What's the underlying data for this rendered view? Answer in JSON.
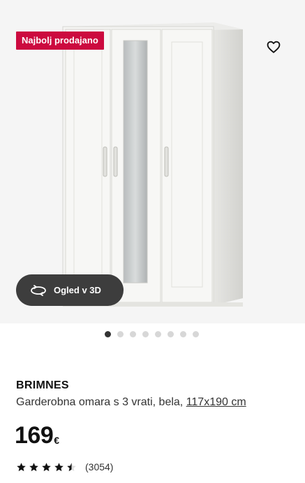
{
  "badge": {
    "label": "Najbolj prodajano"
  },
  "viewer": {
    "label": "Ogled v 3D"
  },
  "gallery": {
    "slides": 8,
    "active_index": 0
  },
  "product": {
    "brand": "BRIMNES",
    "description": "Garderobna omara s 3 vrati, bela,",
    "size_link": "117x190 cm",
    "price": "169",
    "currency": "€",
    "rating": 4.5,
    "rating_max": 5,
    "review_count": "(3054)"
  },
  "colors": {
    "badge": "#cc0a3f",
    "button": "#3d3d3d"
  },
  "icons": {
    "favorite": "heart-icon",
    "rotate": "rotate-3d-icon",
    "star": "star-icon"
  }
}
